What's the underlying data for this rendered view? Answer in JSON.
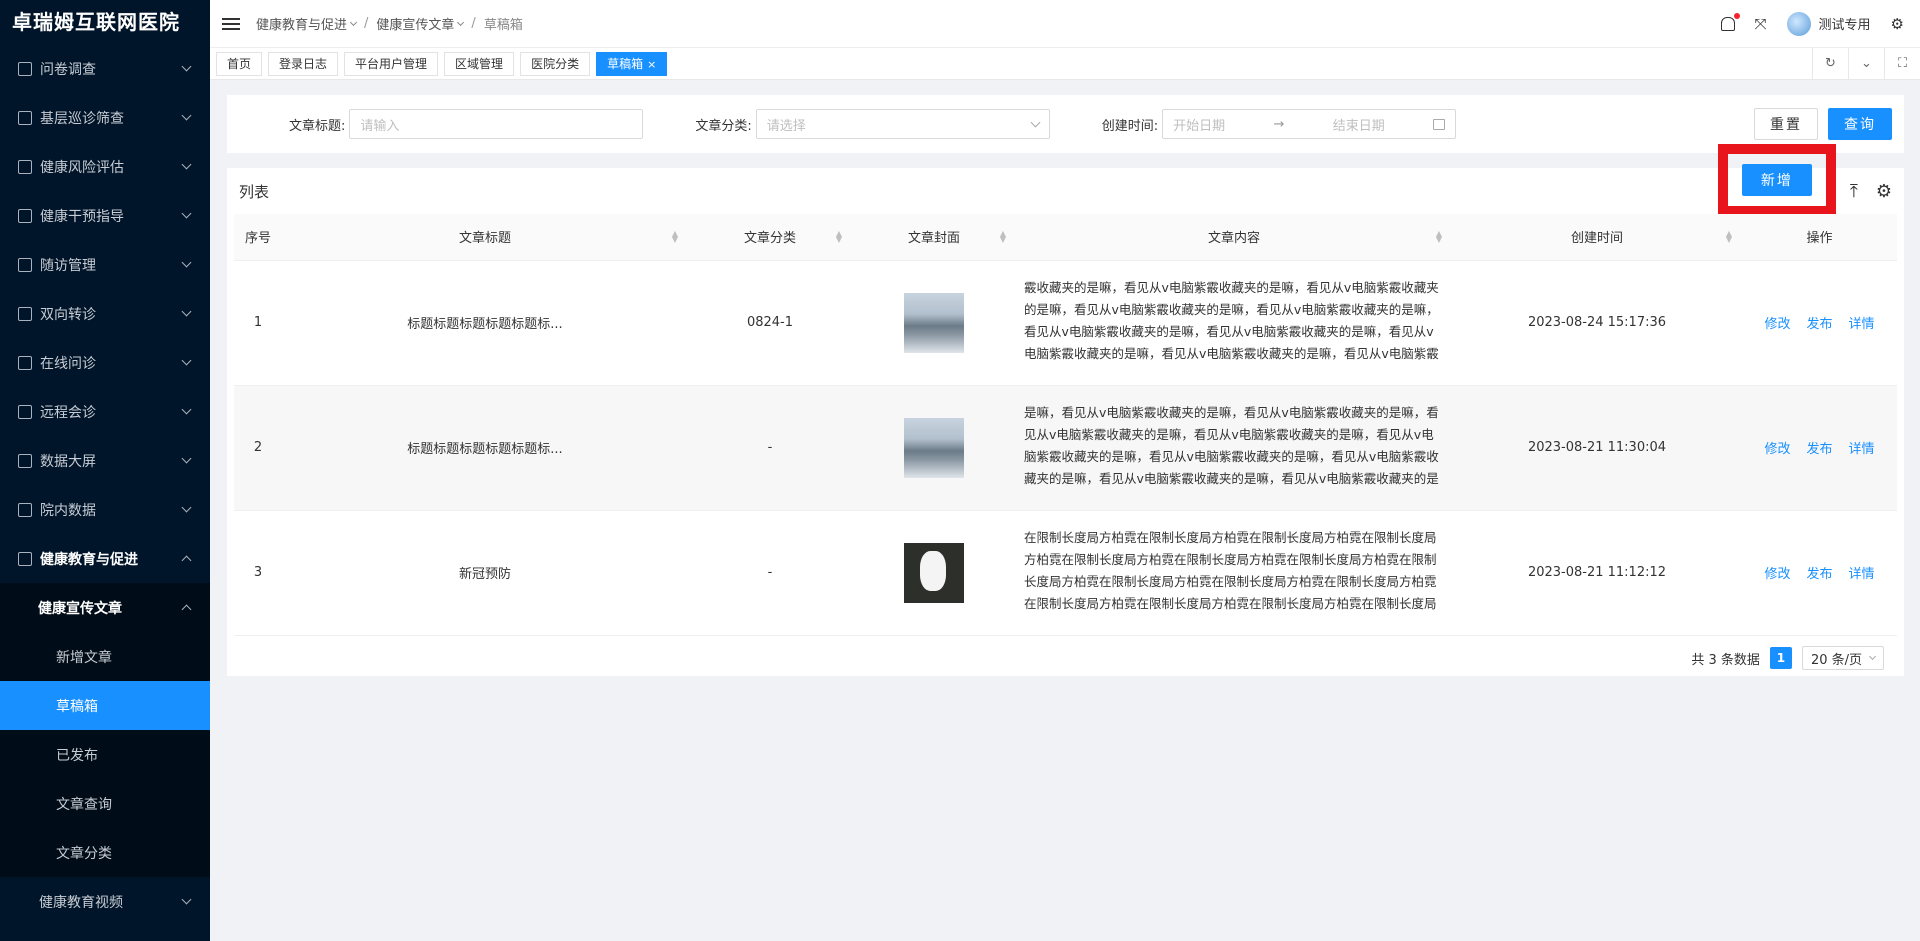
{
  "app": {
    "title": "卓瑞姆互联网医院"
  },
  "sidebar": {
    "items": [
      {
        "label": "问卷调查"
      },
      {
        "label": "基层巡诊筛查"
      },
      {
        "label": "健康风险评估"
      },
      {
        "label": "健康干预指导"
      },
      {
        "label": "随访管理"
      },
      {
        "label": "双向转诊"
      },
      {
        "label": "在线问诊"
      },
      {
        "label": "远程会诊"
      },
      {
        "label": "数据大屏"
      },
      {
        "label": "院内数据"
      },
      {
        "label": "健康教育与促进"
      }
    ],
    "sub": {
      "label": "健康宣传文章",
      "children": [
        {
          "label": "新增文章"
        },
        {
          "label": "草稿箱"
        },
        {
          "label": "已发布"
        },
        {
          "label": "文章查询"
        },
        {
          "label": "文章分类"
        }
      ]
    },
    "last": {
      "label": "健康教育视频"
    }
  },
  "header": {
    "breadcrumb": [
      "健康教育与促进",
      "健康宣传文章",
      "草稿箱"
    ],
    "user": "测试专用"
  },
  "tabs": [
    "首页",
    "登录日志",
    "平台用户管理",
    "区域管理",
    "医院分类",
    "草稿箱"
  ],
  "search": {
    "title_label": "文章标题:",
    "title_placeholder": "请输入",
    "category_label": "文章分类:",
    "category_placeholder": "请选择",
    "time_label": "创建时间:",
    "start_placeholder": "开始日期",
    "end_placeholder": "结束日期",
    "reset": "重置",
    "query": "查询"
  },
  "list": {
    "title": "列表",
    "add": "新增",
    "columns": [
      "序号",
      "文章标题",
      "文章分类",
      "文章封面",
      "文章内容",
      "创建时间",
      "操作"
    ],
    "rows": [
      {
        "index": "1",
        "title": "标题标题标题标题标题标...",
        "category": "0824-1",
        "cover": "mountain",
        "content": "霰收藏夹的是嘛，看见从v电脑紫霰收藏夹的是嘛，看见从v电脑紫霰收藏夹的是嘛，看见从v电脑紫霰收藏夹的是嘛，看见从v电脑紫霰收藏夹的是嘛，看见从v电脑紫霰收藏夹的是嘛，看见从v电脑紫霰收藏夹的是嘛，看见从v电脑紫霰收藏夹的是嘛，看见从v电脑紫霰收藏夹的是嘛，看见从v电脑紫霰收藏夹的是嘛，看见从v电脑紫霰收藏夹的是嘛，看见从v电脑紫",
        "created": "2023-08-24 15:17:36",
        "ops": [
          "修改",
          "发布",
          "详情"
        ]
      },
      {
        "index": "2",
        "title": "标题标题标题标题标题标...",
        "category": "-",
        "cover": "mountain",
        "content": "是嘛，看见从v电脑紫霰收藏夹的是嘛，看见从v电脑紫霰收藏夹的是嘛，看见从v电脑紫霰收藏夹的是嘛，看见从v电脑紫霰收藏夹的是嘛，看见从v电脑紫霰收藏夹的是嘛，看见从v电脑紫霰收藏夹的是嘛，看见从v电脑紫霰收藏夹的是嘛，看见从v电脑紫霰收藏夹的是嘛，看见从v电脑紫霰收藏夹的是嘛，看见从v电脑紫霰收藏夹的是嘛，看见从v电脑紫霰收藏夹的",
        "created": "2023-08-21 11:30:04",
        "ops": [
          "修改",
          "发布",
          "详情"
        ]
      },
      {
        "index": "3",
        "title": "新冠预防",
        "category": "-",
        "cover": "dog",
        "content": "在限制长度局方柏霓在限制长度局方柏霓在限制长度局方柏霓在限制长度局方柏霓在限制长度局方柏霓在限制长度局方柏霓在限制长度局方柏霓在限制长度局方柏霓在限制长度局方柏霓在限制长度局方柏霓在限制长度局方柏霓在限制长度局方柏霓在限制长度局方柏霓在限制长度局方柏霓在限制长度局方柏霓在限制长度局方柏霓",
        "created": "2023-08-21 11:12:12",
        "ops": [
          "修改",
          "发布",
          "详情"
        ]
      }
    ]
  },
  "pagination": {
    "total_text": "共 3 条数据",
    "page": "1",
    "page_size": "20 条/页"
  }
}
